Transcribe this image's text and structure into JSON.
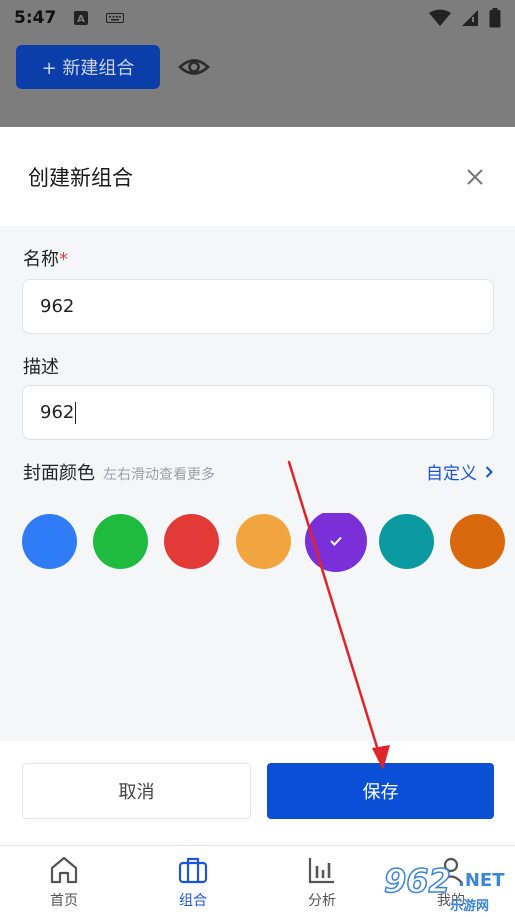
{
  "status_bar": {
    "time": "5:47"
  },
  "background": {
    "new_group_label": "+ 新建组合"
  },
  "sheet": {
    "title": "创建新组合",
    "name_label": "名称",
    "required_mark": "*",
    "name_value": "962",
    "desc_label": "描述",
    "desc_value": "962",
    "cover_label": "封面颜色",
    "cover_hint": "左右滑动查看更多",
    "custom_label": "自定义",
    "swatches": [
      {
        "color": "#2f7cf6",
        "selected": false
      },
      {
        "color": "#1ebb3f",
        "selected": false
      },
      {
        "color": "#e23a36",
        "selected": false
      },
      {
        "color": "#f2a53e",
        "selected": false
      },
      {
        "color": "#7b2fd9",
        "selected": true
      },
      {
        "color": "#0a9a9f",
        "selected": false
      },
      {
        "color": "#d9690c",
        "selected": false
      }
    ],
    "cancel_label": "取消",
    "save_label": "保存"
  },
  "nav": {
    "items": [
      {
        "label": "首页",
        "icon": "home-icon",
        "active": false
      },
      {
        "label": "组合",
        "icon": "briefcase-icon",
        "active": true
      },
      {
        "label": "分析",
        "icon": "bar-chart-icon",
        "active": false
      },
      {
        "label": "我的",
        "icon": "user-icon",
        "active": false
      }
    ]
  },
  "watermark": {
    "brand": "962",
    "suffix": ".NET",
    "sub": "乐游网"
  },
  "colors": {
    "accent": "#0a4fd6",
    "link": "#1a56db",
    "annotation_arrow": "#e0242b"
  }
}
